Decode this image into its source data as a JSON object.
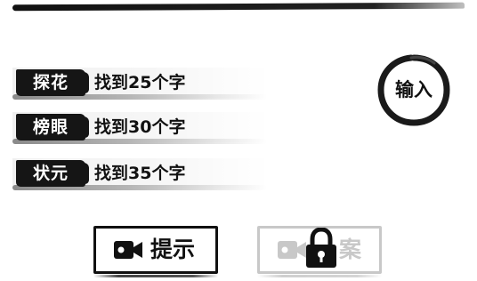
{
  "ranks": [
    {
      "title": "探花",
      "requirement": "找到25个字"
    },
    {
      "title": "榜眼",
      "requirement": "找到30个字"
    },
    {
      "title": "状元",
      "requirement": "找到35个字"
    }
  ],
  "input_button": {
    "label": "输入"
  },
  "hint_button": {
    "label": "提示",
    "icon": "video-icon"
  },
  "answer_button": {
    "label": "案",
    "icon": "video-icon",
    "lock_icon": "lock-icon",
    "enabled": false
  },
  "colors": {
    "ink": "#111111",
    "disabled": "#c8c8c8",
    "background": "#ffffff"
  }
}
